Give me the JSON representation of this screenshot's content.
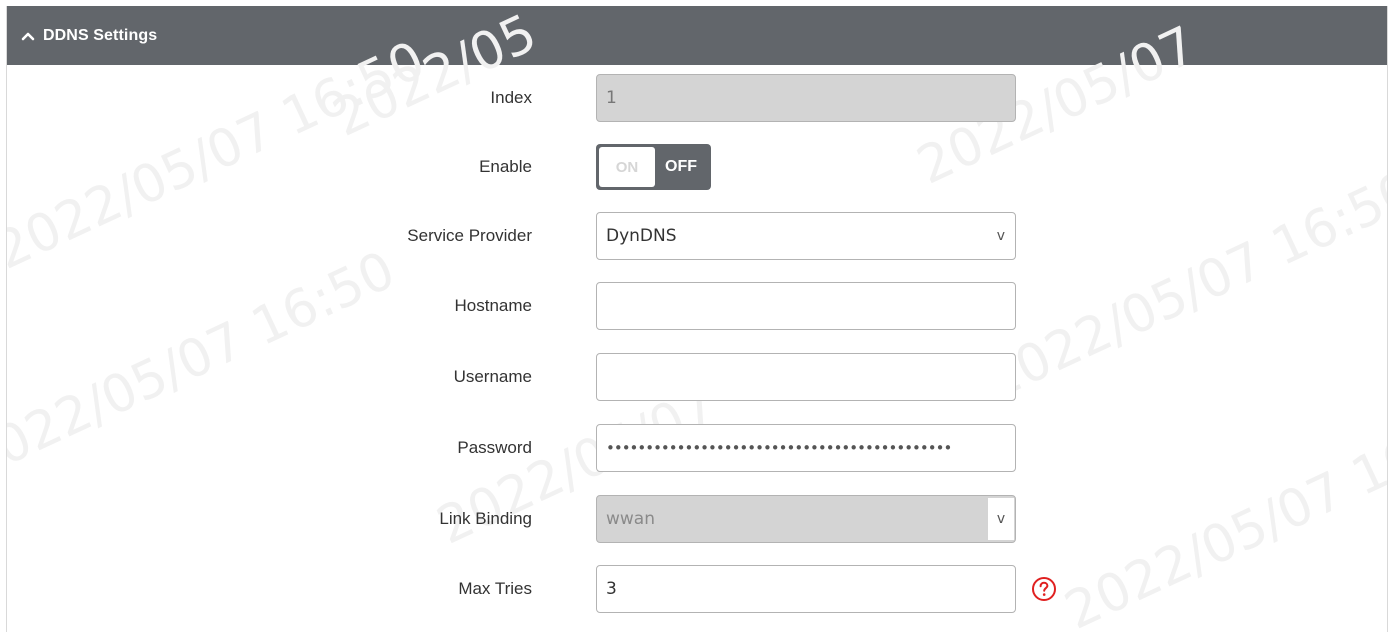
{
  "panel": {
    "title": "DDNS Settings",
    "collapse_icon": "chevron-up-icon"
  },
  "form": {
    "index": {
      "label": "Index",
      "value": "1"
    },
    "enable": {
      "label": "Enable",
      "on_text": "ON",
      "off_text": "OFF",
      "state": "off"
    },
    "service_provider": {
      "label": "Service Provider",
      "value": "DynDNS",
      "caret": "v"
    },
    "hostname": {
      "label": "Hostname",
      "value": "",
      "placeholder": ""
    },
    "username": {
      "label": "Username",
      "value": "",
      "placeholder": ""
    },
    "password": {
      "label": "Password",
      "masked_value": "••••••••••••••••••••••••••••••••••••••••••••"
    },
    "link_binding": {
      "label": "Link Binding",
      "value": "wwan",
      "caret": "v"
    },
    "max_tries": {
      "label": "Max Tries",
      "value": "3",
      "help_icon": "question-circle-icon"
    }
  },
  "colors": {
    "header_bg": "#62666b",
    "help_red": "#e02020",
    "readonly_bg": "#d4d4d4"
  }
}
